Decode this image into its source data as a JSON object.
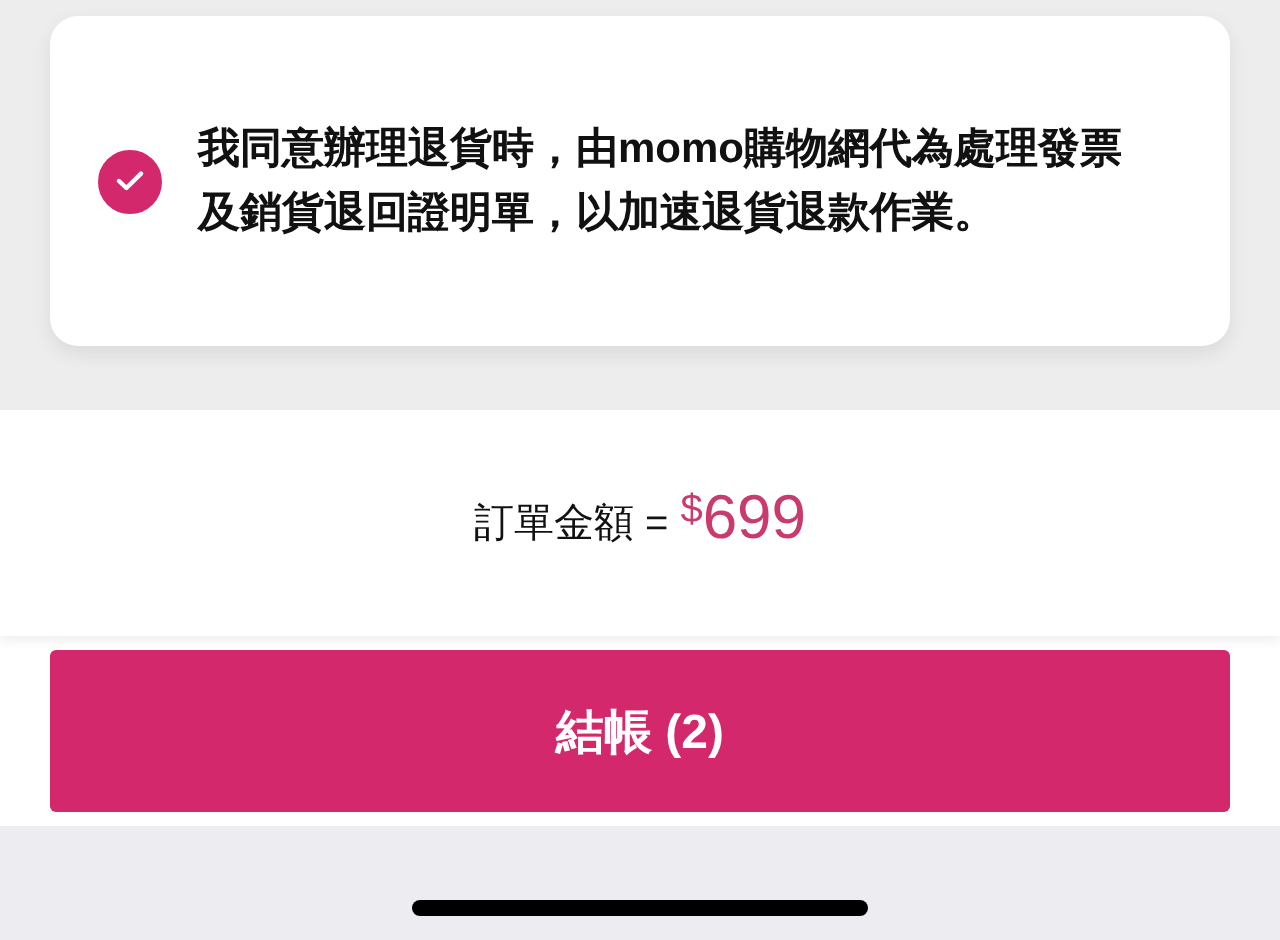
{
  "agreement": {
    "checked": true,
    "text": "我同意辦理退貨時，由momo購物網代為處理發票及銷貨退回證明單，以加速退貨退款作業。"
  },
  "total": {
    "label": "訂單金額 =",
    "currency": "$",
    "amount": "699"
  },
  "checkout_button": {
    "label": "結帳 (2)"
  }
}
